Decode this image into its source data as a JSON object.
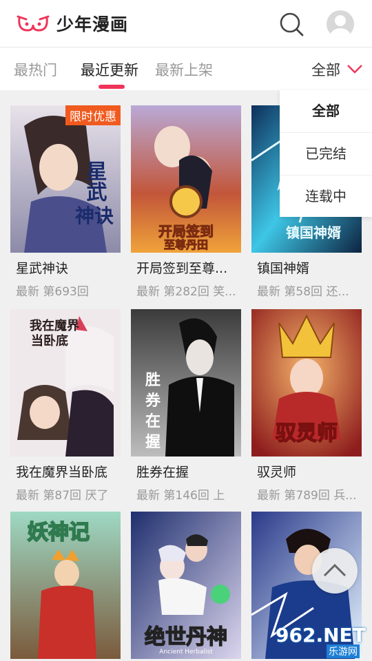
{
  "app": {
    "title": "少年漫画"
  },
  "tabs": [
    {
      "label": "最热门"
    },
    {
      "label": "最近更新"
    },
    {
      "label": "最新上架"
    }
  ],
  "filter": {
    "label": "全部",
    "options": [
      "全部",
      "已完结",
      "连载中"
    ]
  },
  "comics": [
    {
      "name": "星武神诀",
      "update": "最新 第693回",
      "badge": "限时优惠",
      "cover_text": "星武神诀"
    },
    {
      "name": "开局签到至尊...",
      "update": "最新 第282回 笑...",
      "cover_text": "开局签到至尊丹田"
    },
    {
      "name": "镇国神婿",
      "update": "最新 第58回 还...",
      "cover_text": "镇国神婿"
    },
    {
      "name": "我在魔界当卧底",
      "update": "最新 第87回 厌了",
      "cover_text": "我在魔界当卧底"
    },
    {
      "name": "胜券在握",
      "update": "最新 第146回 上",
      "cover_text": "胜券在握"
    },
    {
      "name": "驭灵师",
      "update": "最新 第789回 兵...",
      "cover_text": "驭灵师"
    },
    {
      "name": "",
      "update": "",
      "cover_text": "妖神记"
    },
    {
      "name": "",
      "update": "",
      "cover_text": "绝世丹神",
      "cover_subtext": "Ancient Herbalist"
    },
    {
      "name": "",
      "update": "",
      "cover_text": ""
    }
  ],
  "watermark": {
    "brand": "962.NET",
    "sub": "乐游网"
  },
  "colors": {
    "accent": "#f0345a",
    "badge": "#f05a1e"
  }
}
